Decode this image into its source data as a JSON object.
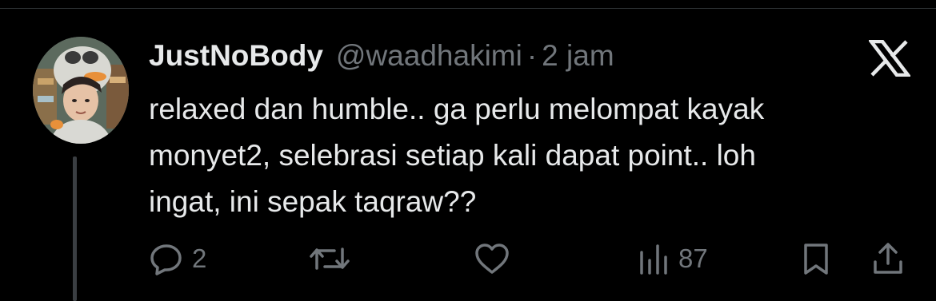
{
  "tweet": {
    "display_name": "JustNoBody",
    "handle": "@waadhakimi",
    "separator": "·",
    "time": "2 jam",
    "text_lines": [
      "relaxed dan humble.. ga perlu melompat kayak",
      "monyet2, selebrasi setiap kali dapat point.. loh",
      "ingat, ini sepak taqraw??"
    ]
  },
  "actions": {
    "reply_count": "2",
    "views_count": "87"
  },
  "icons": {
    "brand": "x-logo-icon",
    "reply": "reply-icon",
    "repost": "repost-icon",
    "like": "heart-icon",
    "views": "views-icon",
    "bookmark": "bookmark-icon",
    "share": "share-icon"
  },
  "colors": {
    "background": "#000000",
    "primary_text": "#e7e9ea",
    "secondary_text": "#71767b",
    "thread_line": "#3a3e42"
  }
}
